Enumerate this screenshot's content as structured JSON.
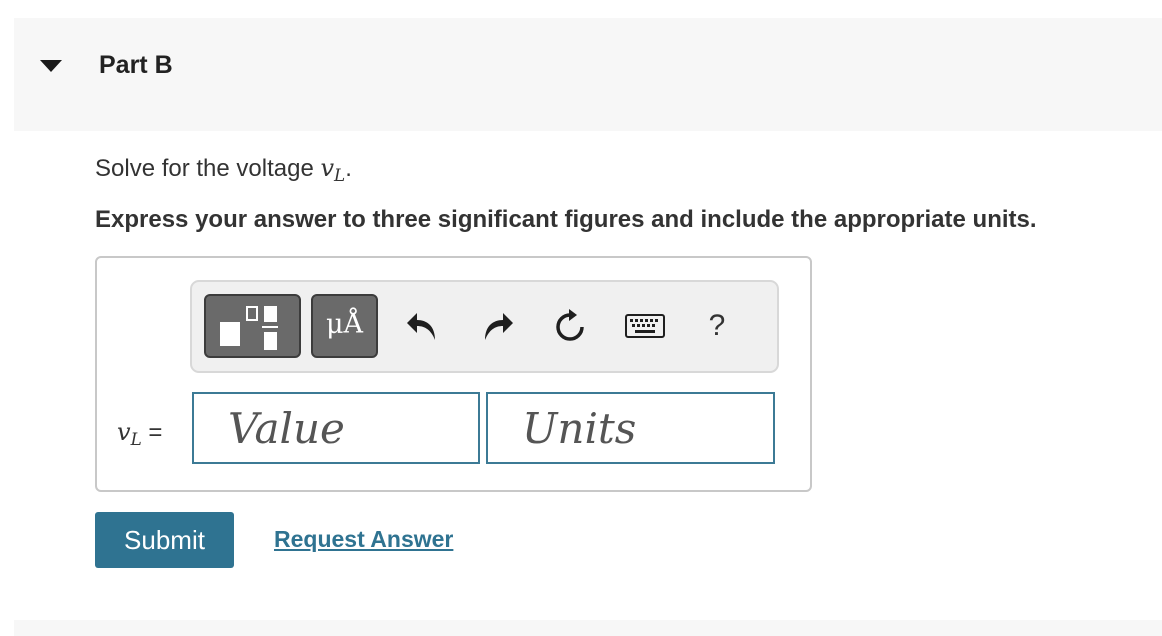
{
  "part": {
    "title": "Part B"
  },
  "question": {
    "prompt_prefix": "Solve for the voltage ",
    "variable_base": "v",
    "variable_sub": "L",
    "prompt_suffix": ".",
    "instruction": "Express your answer to three significant figures and include the appropriate units."
  },
  "toolbar": {
    "units_button_label": "μÅ",
    "help_label": "?",
    "icons": [
      "fraction-template-icon",
      "units-icon",
      "undo-icon",
      "redo-icon",
      "reset-icon",
      "keyboard-icon",
      "help-icon"
    ]
  },
  "answer": {
    "label_base": "v",
    "label_sub": "L",
    "label_eq": " =",
    "value_placeholder": "Value",
    "units_placeholder": "Units"
  },
  "actions": {
    "submit_label": "Submit",
    "request_answer_label": "Request Answer"
  },
  "colors": {
    "accent": "#2f7391",
    "field_border": "#3c7a95",
    "toolbar_button": "#6a6a6a",
    "header_bg": "#f7f7f7"
  }
}
